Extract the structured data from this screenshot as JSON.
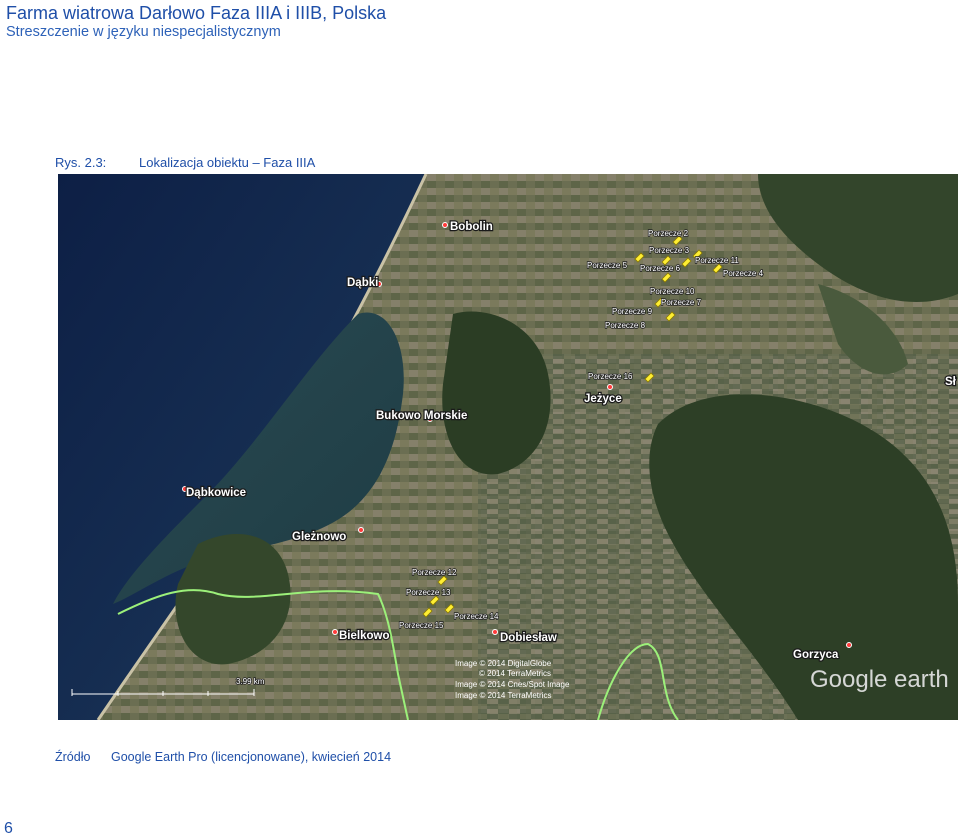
{
  "header": {
    "title": "Farma wiatrowa Darłowo Faza IIIA i IIIB, Polska",
    "subtitle": "Streszczenie w języku niespecjalistycznym"
  },
  "figure": {
    "number": "Rys. 2.3:",
    "title": "Lokalizacja obiektu – Faza IIIA"
  },
  "map": {
    "places": [
      "Bobolin",
      "Dąbki",
      "Bukowo Morskie",
      "Jeżyce",
      "Dąbkowice",
      "Gleżnowo",
      "Bielkowo",
      "Dobiesław",
      "Gorzyca",
      "Sł"
    ],
    "turbines": [
      "Porzecze 2",
      "Porzecze 3",
      "Porzecze 5",
      "Porzecze 6",
      "Porzecze 11",
      "Porzecze 4",
      "Porzecze 10",
      "Porzecze 7",
      "Porzecze 9",
      "Porzecze 8",
      "Porzecze 16",
      "Porzecze 12",
      "Porzecze 13",
      "Porzecze 14",
      "Porzecze 15"
    ],
    "credits": [
      "Image © 2014 DigitalGlobe",
      "© 2014 TerraMetrics",
      "Image © 2014 Cnes/Spot Image",
      "Image © 2014 TerraMetrics"
    ],
    "scale": "3.99 km",
    "logo": "Google earth"
  },
  "source": {
    "label": "Źródło",
    "text": "Google Earth Pro (licencjonowane), kwiecień 2014"
  },
  "page_number": "6"
}
